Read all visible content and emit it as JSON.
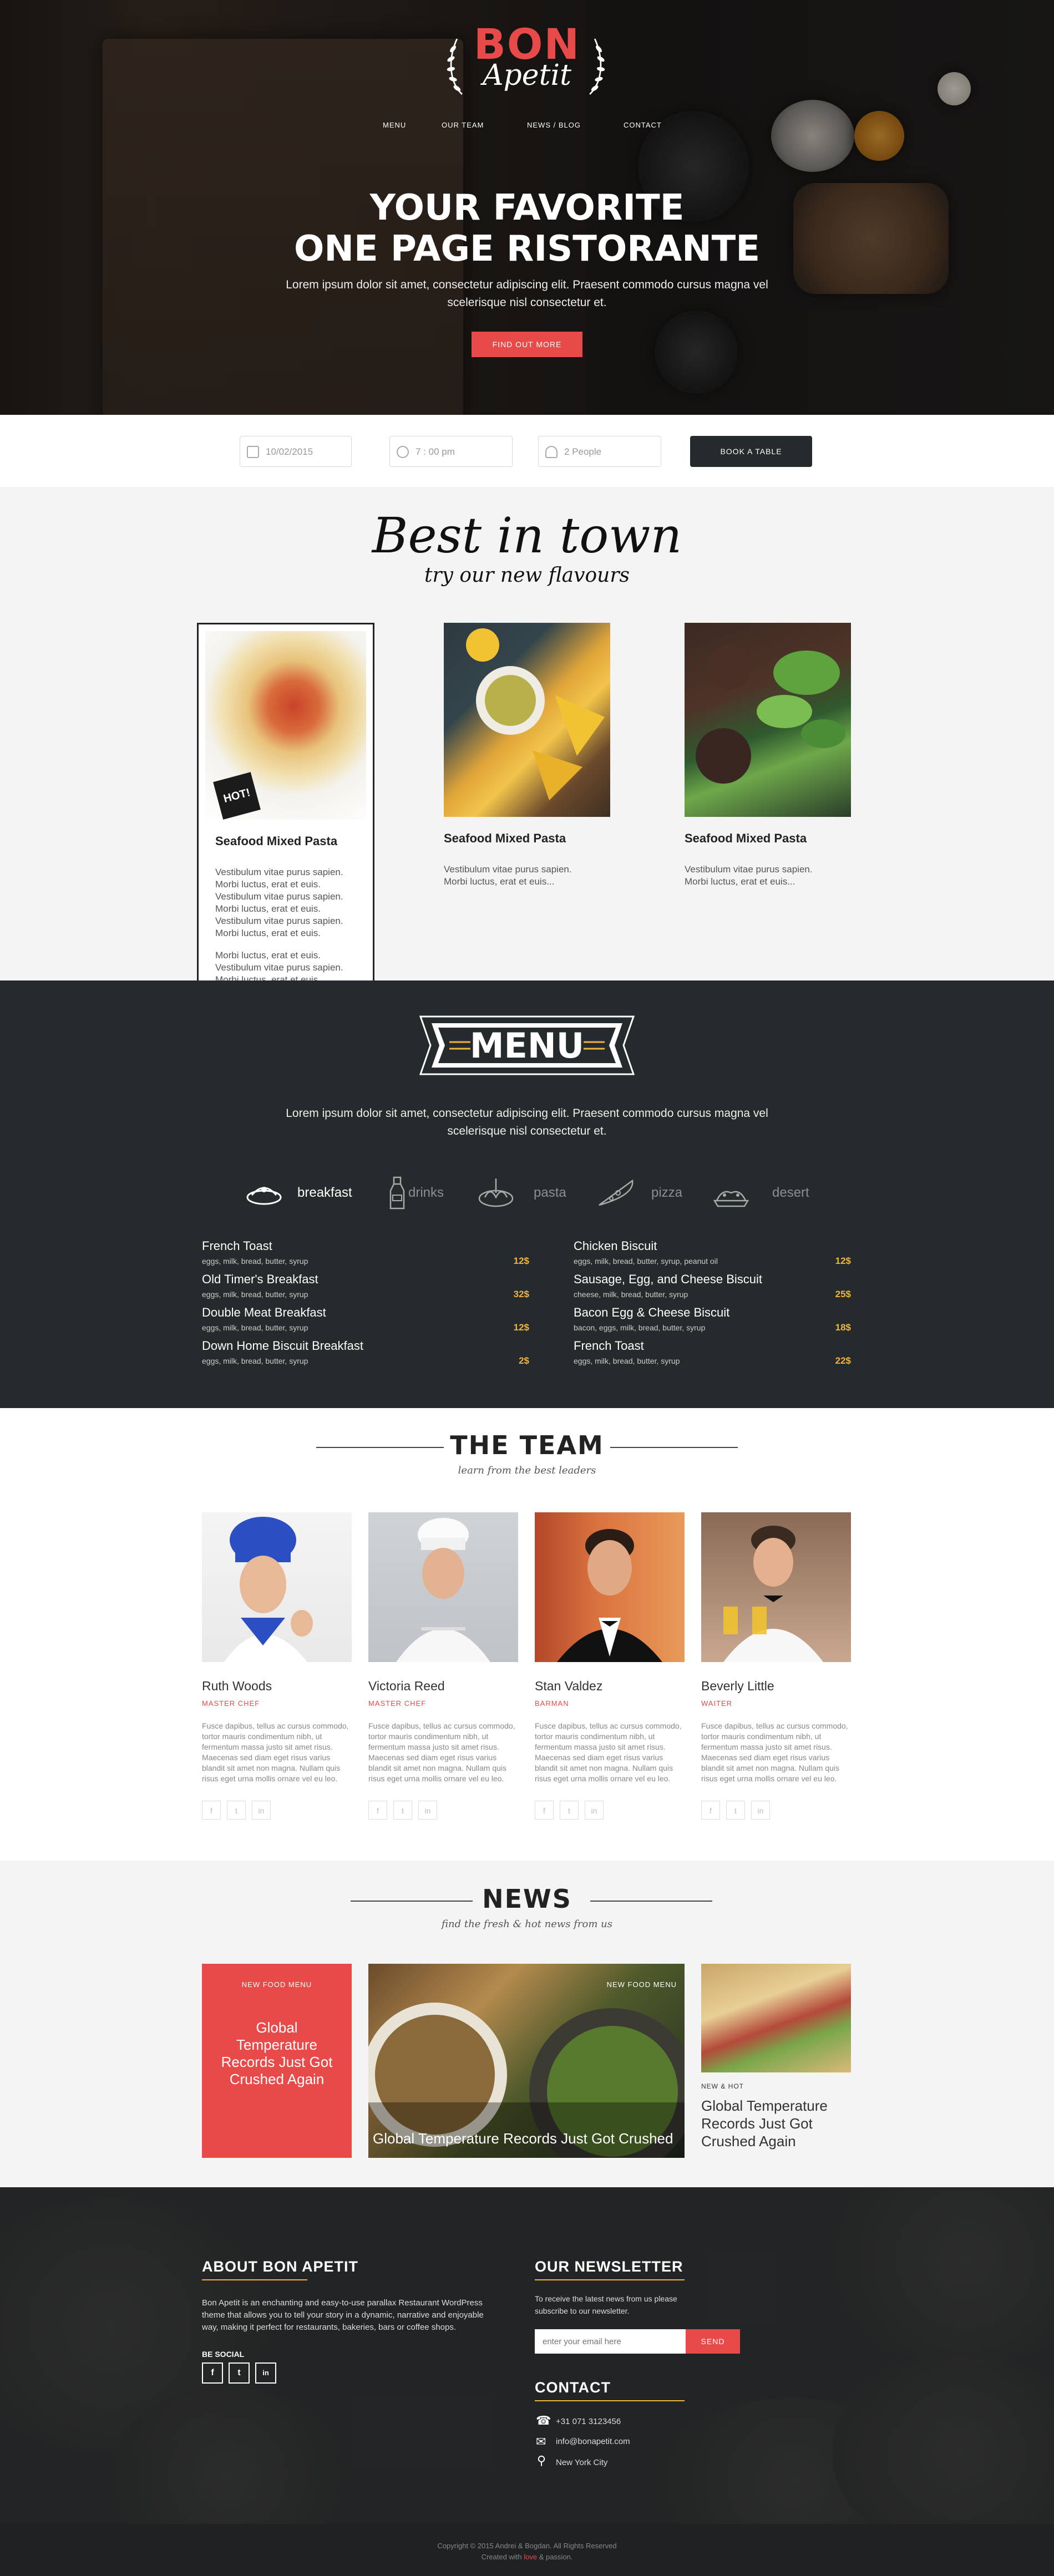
{
  "brand": {
    "name_top": "BON",
    "name_script": "Apetit",
    "accent": "#e84a4a",
    "gold": "#f0b43c",
    "dark": "#252a2d"
  },
  "nav": [
    "MENU",
    "OUR TEAM",
    "NEWS / BLOG",
    "CONTACT"
  ],
  "hero": {
    "title_line1": "YOUR FAVORITE",
    "title_line2": "ONE PAGE RISTORANTE",
    "subtitle": "Lorem ipsum dolor sit amet, consectetur adipiscing elit. Praesent commodo cursus magna vel scelerisque nisl consectetur et.",
    "cta": "FIND OUT MORE"
  },
  "booking": {
    "date": "10/02/2015",
    "time": "7 : 00 pm",
    "people": "2 People",
    "button": "BOOK A TABLE",
    "icons": [
      "calendar-icon",
      "clock-icon",
      "person-icon"
    ]
  },
  "best": {
    "title": "Best in town",
    "subtitle": "try our new flavours",
    "hot_label": "HOT!",
    "cards": [
      {
        "name": "Seafood Mixed Pasta",
        "desc": "Vestibulum vitae purus sapien. Morbi luctus, erat et euis. Vestibulum vitae purus sapien. Morbi luctus, erat et euis. Vestibulum vitae purus sapien. Morbi luctus, erat et euis.",
        "desc2": "Morbi luctus, erat et euis. Vestibulum vitae purus sapien. Morbi luctus, erat et euis."
      },
      {
        "name": "Seafood Mixed Pasta",
        "desc": "Vestibulum vitae purus sapien. Morbi luctus, erat et euis..."
      },
      {
        "name": "Seafood Mixed Pasta",
        "desc": "Vestibulum vitae purus sapien. Morbi luctus, erat et euis..."
      }
    ]
  },
  "menu": {
    "title": "MENU",
    "subtitle": "Lorem ipsum dolor sit amet, consectetur adipiscing elit. Praesent commodo cursus magna vel scelerisque nisl consectetur et.",
    "categories": [
      "breakfast",
      "drinks",
      "pasta",
      "pizza",
      "desert"
    ],
    "left": [
      {
        "title": "French Toast",
        "ing": "eggs, milk, bread, butter, syrup",
        "price": "12$"
      },
      {
        "title": "Old Timer's Breakfast",
        "ing": "eggs, milk, bread, butter, syrup",
        "price": "32$"
      },
      {
        "title": "Double Meat Breakfast",
        "ing": "eggs, milk, bread, butter, syrup",
        "price": "12$"
      },
      {
        "title": "Down Home Biscuit Breakfast",
        "ing": "eggs, milk, bread, butter, syrup",
        "price": "2$"
      }
    ],
    "right": [
      {
        "title": "Chicken Biscuit",
        "ing": "eggs, milk, bread, butter, syrup, peanut oil",
        "price": "12$"
      },
      {
        "title": "Sausage, Egg, and Cheese Biscuit",
        "ing": "cheese, milk, bread, butter, syrup",
        "price": "25$"
      },
      {
        "title": "Bacon Egg & Cheese Biscuit",
        "ing": "bacon, eggs, milk, bread, butter, syrup",
        "price": "18$"
      },
      {
        "title": "French Toast",
        "ing": "eggs, milk, bread, butter, syrup",
        "price": "22$"
      }
    ]
  },
  "team": {
    "title": "THE TEAM",
    "subtitle": "learn from the best leaders",
    "members": [
      {
        "name": "Ruth Woods",
        "role": "MASTER CHEF",
        "bio": "Fusce dapibus, tellus ac cursus commodo, tortor mauris condimentum nibh, ut fermentum massa justo sit amet risus. Maecenas sed diam eget risus varius blandit sit amet non magna. Nullam quis risus eget urna mollis ornare vel eu leo."
      },
      {
        "name": "Victoria Reed",
        "role": "MASTER CHEF",
        "bio": "Fusce dapibus, tellus ac cursus commodo, tortor mauris condimentum nibh, ut fermentum massa justo sit amet risus. Maecenas sed diam eget risus varius blandit sit amet non magna. Nullam quis risus eget urna mollis ornare vel eu leo."
      },
      {
        "name": "Stan Valdez",
        "role": "BARMAN",
        "bio": "Fusce dapibus, tellus ac cursus commodo, tortor mauris condimentum nibh, ut fermentum massa justo sit amet risus. Maecenas sed diam eget risus varius blandit sit amet non magna. Nullam quis risus eget urna mollis ornare vel eu leo."
      },
      {
        "name": "Beverly Little",
        "role": "WAITER",
        "bio": "Fusce dapibus, tellus ac cursus commodo, tortor mauris condimentum nibh, ut fermentum massa justo sit amet risus. Maecenas sed diam eget risus varius blandit sit amet non magna. Nullam quis risus eget urna mollis ornare vel eu leo."
      }
    ],
    "social": [
      "f",
      "t",
      "in"
    ]
  },
  "news": {
    "title": "NEWS",
    "subtitle": "find the fresh & hot news from us",
    "card1": {
      "tag": "NEW FOOD MENU",
      "title": "Global Temperature Records Just Got Crushed Again"
    },
    "card2": {
      "tag": "NEW FOOD MENU",
      "title": "Global Temperature Records Just Got Crushed"
    },
    "card3": {
      "tag": "NEW & HOT",
      "title": "Global Temperature Records Just Got Crushed Again"
    }
  },
  "footer": {
    "about_title": "ABOUT BON APETIT",
    "about_text": "Bon Apetit is an enchanting and easy-to-use parallax Restaurant WordPress theme that allows you to tell your story in a dynamic, narrative and enjoyable way, making it perfect for restaurants, bakeries, bars or coffee shops.",
    "be_social": "BE SOCIAL",
    "social": [
      "f",
      "t",
      "in"
    ],
    "newsletter_title": "OUR NEWSLETTER",
    "newsletter_text": "To receive the latest news from us please subscribe to our newsletter.",
    "email_placeholder": "enter your email here",
    "send": "SEND",
    "contact_title": "CONTACT",
    "phone": "+31 071 3123456",
    "email": "info@bonapetit.com",
    "city": "New York City",
    "copyright": "Copyright © 2015 Andrei & Bogdan. All Rights Reserved",
    "created_prefix": "Created with",
    "created_love": "love",
    "created_suffix": "& passion."
  }
}
